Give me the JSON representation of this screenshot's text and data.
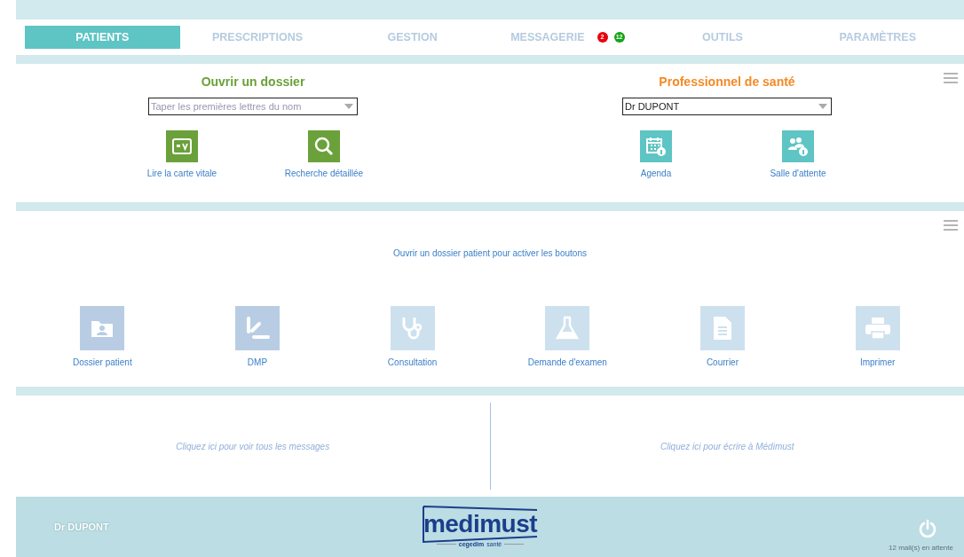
{
  "tabs": [
    {
      "label": "PATIENTS",
      "selected": true
    },
    {
      "label": "PRESCRIPTIONS",
      "selected": false
    },
    {
      "label": "GESTION",
      "selected": false
    },
    {
      "label": "MESSAGERIE",
      "selected": false,
      "badges": [
        {
          "count": "2",
          "color": "#e8000b"
        },
        {
          "count": "12",
          "color": "#17a317"
        }
      ]
    },
    {
      "label": "OUTILS",
      "selected": false
    },
    {
      "label": "PARAMÈTRES",
      "selected": false
    }
  ],
  "open_file": {
    "title": "Ouvrir un dossier",
    "search": {
      "placeholder": "Taper les premières lettres du nom"
    },
    "actions": [
      {
        "kind": "card",
        "label": "Lire la carte vitale"
      },
      {
        "kind": "search",
        "label": "Recherche détaillée"
      }
    ]
  },
  "professional": {
    "title": "Professionnel de santé",
    "select": {
      "value": "Dr DUPONT"
    },
    "actions": [
      {
        "kind": "calendar",
        "label": "Agenda"
      },
      {
        "kind": "people",
        "label": "Salle d'attente"
      }
    ]
  },
  "patient_panel": {
    "message": "Ouvrir un dossier patient pour activer les boutons",
    "actions": [
      {
        "kind": "folder",
        "label": "Dossier patient",
        "disabled": false
      },
      {
        "kind": "dmp",
        "label": "DMP",
        "disabled": false
      },
      {
        "kind": "stethoscope",
        "label": "Consultation",
        "disabled": true
      },
      {
        "kind": "flask",
        "label": "Demande d'examen",
        "disabled": true
      },
      {
        "kind": "document",
        "label": "Courrier",
        "disabled": true
      },
      {
        "kind": "printer",
        "label": "Imprimer",
        "disabled": true
      }
    ]
  },
  "messages": {
    "left": "Cliquez ici pour voir tous les messages",
    "right": "Cliquez ici pour écrire à Médimust"
  },
  "footer": {
    "user": "Dr DUPONT",
    "logo": "medimust",
    "logo_sub_1": "cegedim",
    "logo_sub_2": "santé",
    "mail_status": "12 mail(s) en attente"
  }
}
